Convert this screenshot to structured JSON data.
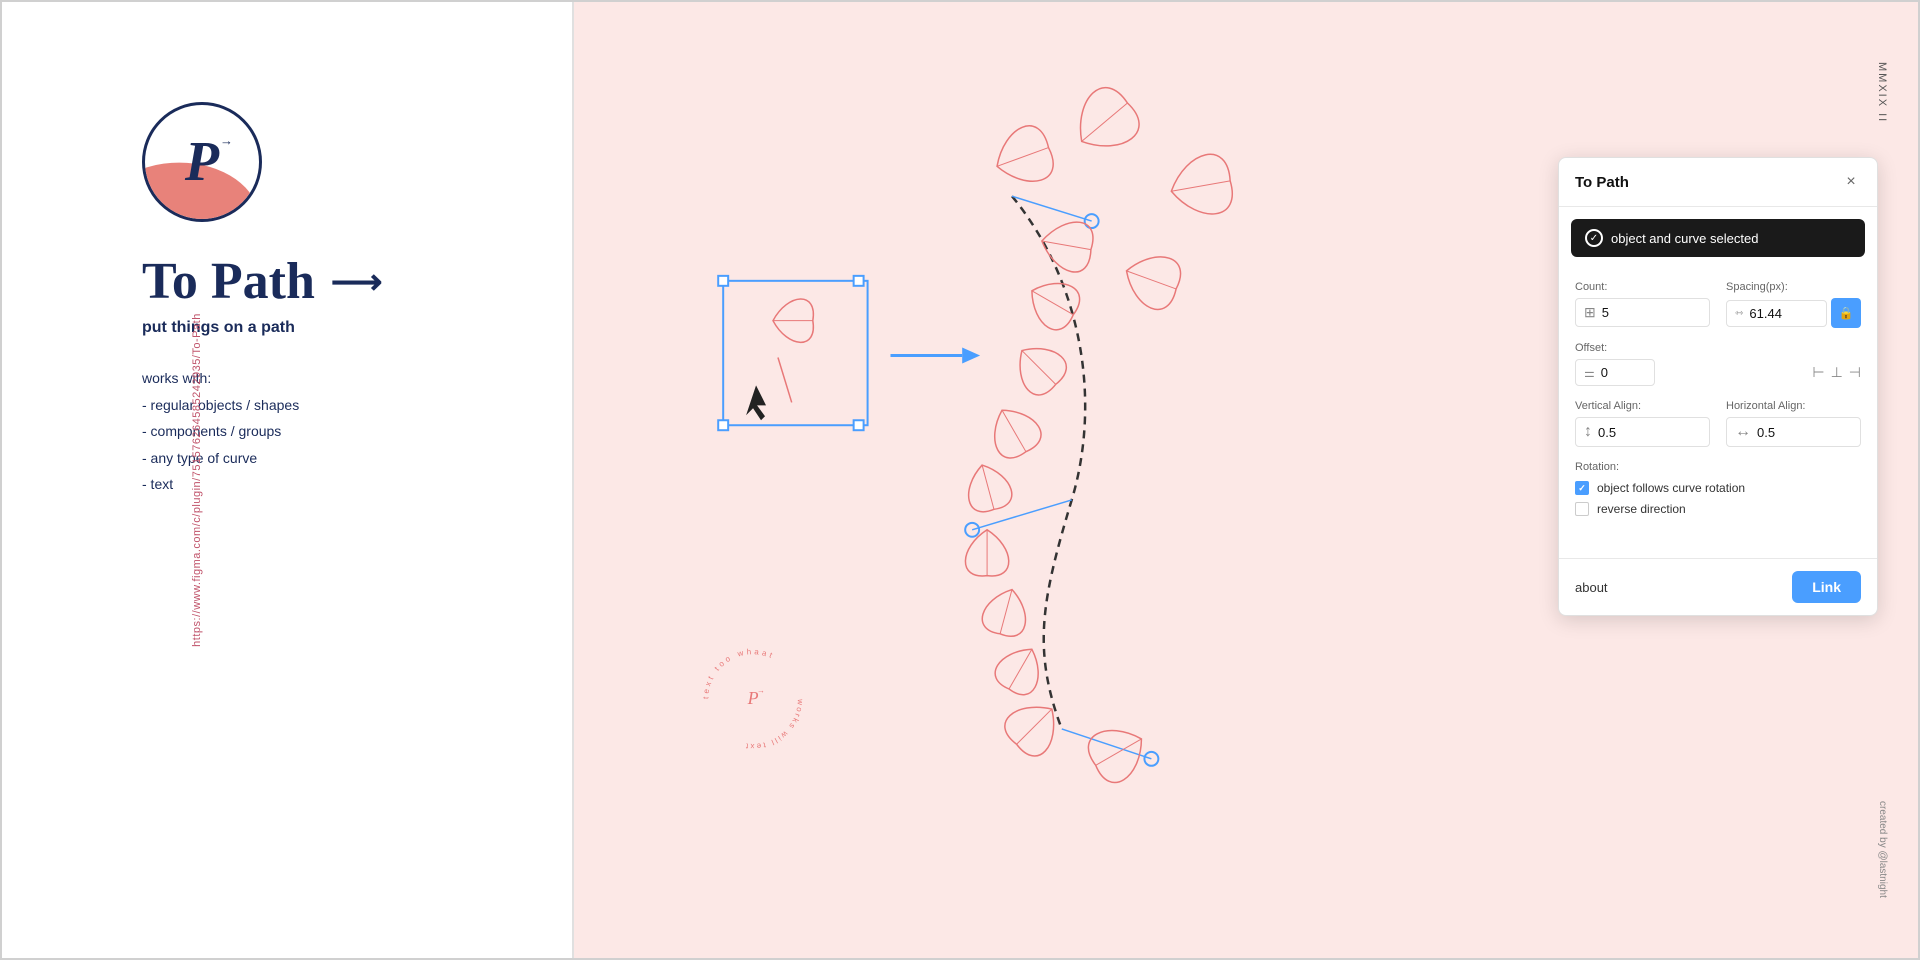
{
  "app": {
    "url": "https://www.figma.com/c/plugin/751576264585242935/To-Path",
    "mmxix": "MMXIX II",
    "created_by": "created by @lastnight"
  },
  "left_panel": {
    "logo_letter": "P",
    "title": "To Path",
    "subtitle": "put things on a path",
    "works_with_heading": "works with:",
    "works_with_items": [
      "- regular objects / shapes",
      "- components / groups",
      "- any type of curve",
      "- text"
    ]
  },
  "plugin": {
    "title": "To Path",
    "close_label": "×",
    "status": {
      "text": "object and curve selected",
      "icon": "check-circle-icon"
    },
    "count": {
      "label": "Count:",
      "value": "5",
      "icon": "grid-icon"
    },
    "spacing": {
      "label": "Spacing(px):",
      "value": "61.44",
      "icon": "spacing-icon",
      "lock_icon": "lock-icon"
    },
    "offset": {
      "label": "Offset:",
      "value": "0",
      "icon": "lines-icon",
      "align_left": "align-left-icon",
      "align_center": "align-center-icon",
      "align_right": "align-right-icon"
    },
    "vertical_align": {
      "label": "Vertical Align:",
      "value": "0.5",
      "icon": "vertical-arrows-icon"
    },
    "horizontal_align": {
      "label": "Horizontal Align:",
      "value": "0.5",
      "icon": "horizontal-arrows-icon"
    },
    "rotation": {
      "label": "Rotation:",
      "follows_curve": {
        "checked": true,
        "label": "object follows curve rotation"
      },
      "reverse": {
        "checked": false,
        "label": "reverse direction"
      }
    },
    "footer": {
      "about": "about",
      "link_btn": "Link"
    }
  }
}
